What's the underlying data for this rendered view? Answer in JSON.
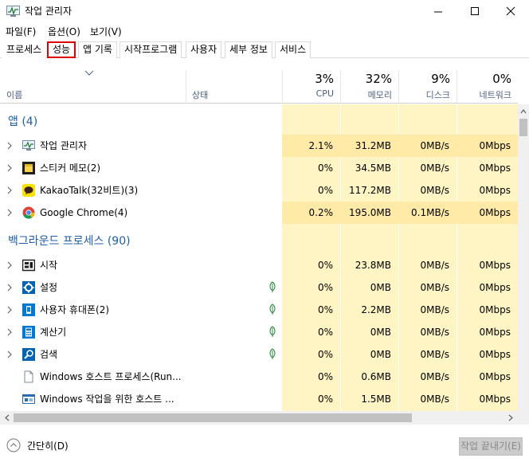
{
  "window": {
    "title": "작업 관리자",
    "icon": "task-manager-icon"
  },
  "menu": [
    {
      "label": "파일(F)"
    },
    {
      "label": "옵션(O)"
    },
    {
      "label": "보기(V)"
    }
  ],
  "tabs": [
    {
      "label": "프로세스"
    },
    {
      "label": "성능",
      "highlighted": true
    },
    {
      "label": "앱 기록"
    },
    {
      "label": "시작프로그램"
    },
    {
      "label": "사용자"
    },
    {
      "label": "세부 정보"
    },
    {
      "label": "서비스"
    }
  ],
  "columns": {
    "name": "이름",
    "status": "상태",
    "cpu": {
      "pct": "3%",
      "label": "CPU"
    },
    "memory": {
      "pct": "32%",
      "label": "메모리"
    },
    "disk": {
      "pct": "9%",
      "label": "디스크"
    },
    "network": {
      "pct": "0%",
      "label": "네트워크"
    }
  },
  "groups": {
    "apps": "앱 (4)",
    "background": "백그라운드 프로세스 (90)"
  },
  "apps": [
    {
      "name": "작업 관리자",
      "icon": "task-manager-icon",
      "cpu": "2.1%",
      "mem": "31.2MB",
      "disk": "0MB/s",
      "net": "0Mbps"
    },
    {
      "name": "스티커 메모(2)",
      "icon": "sticky-notes-icon",
      "cpu": "0%",
      "mem": "34.5MB",
      "disk": "0MB/s",
      "net": "0Mbps"
    },
    {
      "name": "KakaoTalk(32비트)(3)",
      "icon": "kakaotalk-icon",
      "cpu": "0%",
      "mem": "117.2MB",
      "disk": "0MB/s",
      "net": "0Mbps"
    },
    {
      "name": "Google Chrome(4)",
      "icon": "chrome-icon",
      "cpu": "0.2%",
      "mem": "195.0MB",
      "disk": "0.1MB/s",
      "net": "0Mbps"
    }
  ],
  "background": [
    {
      "name": "시작",
      "icon": "start-icon",
      "cpu": "0%",
      "mem": "23.8MB",
      "disk": "0MB/s",
      "net": "0Mbps"
    },
    {
      "name": "설정",
      "icon": "settings-gear-icon",
      "cpu": "0%",
      "mem": "0MB",
      "disk": "0MB/s",
      "net": "0Mbps"
    },
    {
      "name": "사용자 휴대폰(2)",
      "icon": "phone-icon",
      "cpu": "0%",
      "mem": "2.2MB",
      "disk": "0MB/s",
      "net": "0Mbps"
    },
    {
      "name": "계산기",
      "icon": "calculator-icon",
      "cpu": "0%",
      "mem": "0MB",
      "disk": "0MB/s",
      "net": "0Mbps"
    },
    {
      "name": "검색",
      "icon": "search-icon",
      "cpu": "0%",
      "mem": "0MB",
      "disk": "0MB/s",
      "net": "0Mbps"
    },
    {
      "name": "Windows 호스트 프로세스(Run...",
      "icon": "window-document-icon",
      "cpu": "0%",
      "mem": "0.6MB",
      "disk": "0MB/s",
      "net": "0Mbps"
    },
    {
      "name": "Windows 작업을 위한 호스트 ...",
      "icon": "window-app-icon",
      "cpu": "0%",
      "mem": "1.5MB",
      "disk": "0MB/s",
      "net": "0Mbps"
    }
  ],
  "footer": {
    "fewer_details": "간단히(D)",
    "end_task": "작업 끝내기(E)"
  },
  "colors": {
    "heat_light": "#fff4c4",
    "heat_mid": "#ffeaa8",
    "group_text": "#1f5fa8",
    "highlight_border": "#e00000"
  }
}
